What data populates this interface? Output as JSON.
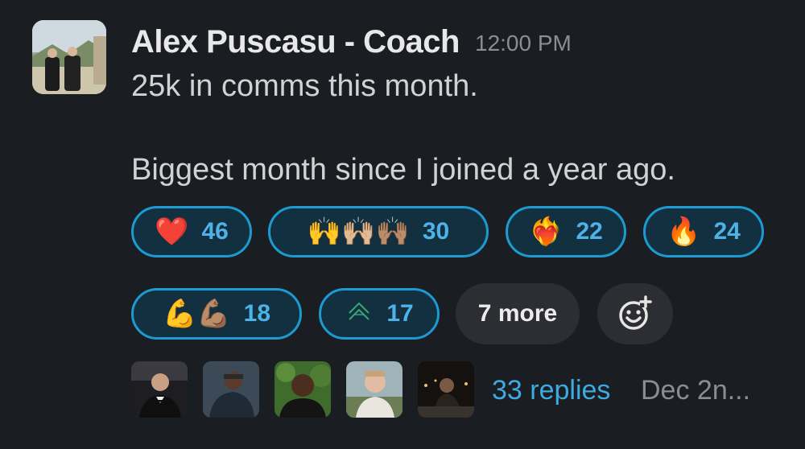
{
  "message": {
    "author": "Alex Puscasu - Coach",
    "time": "12:00 PM",
    "line1": "25k in comms this month.",
    "line2": "Biggest month since I joined a year ago."
  },
  "reactions": [
    {
      "name": "heart",
      "emoji": "❤️",
      "count": "46"
    },
    {
      "name": "raised-hands",
      "emoji": "🙌🙌🏼🙌🏽",
      "count": "30"
    },
    {
      "name": "heart-on-fire",
      "emoji": "❤️‍🔥",
      "count": "22"
    },
    {
      "name": "fire",
      "emoji": "🔥",
      "count": "24"
    },
    {
      "name": "flexed-biceps",
      "emoji": "💪💪🏽",
      "count": "18"
    },
    {
      "name": "custom-chevron",
      "emoji": "",
      "count": "17"
    }
  ],
  "more_label": "7 more",
  "thread": {
    "replies": "33 replies",
    "last_reply": "Dec 2n..."
  },
  "colors": {
    "background": "#1a1d21",
    "reaction_border": "#1d9bd1",
    "reaction_fill": "#12303f",
    "link": "#3eaae3"
  }
}
